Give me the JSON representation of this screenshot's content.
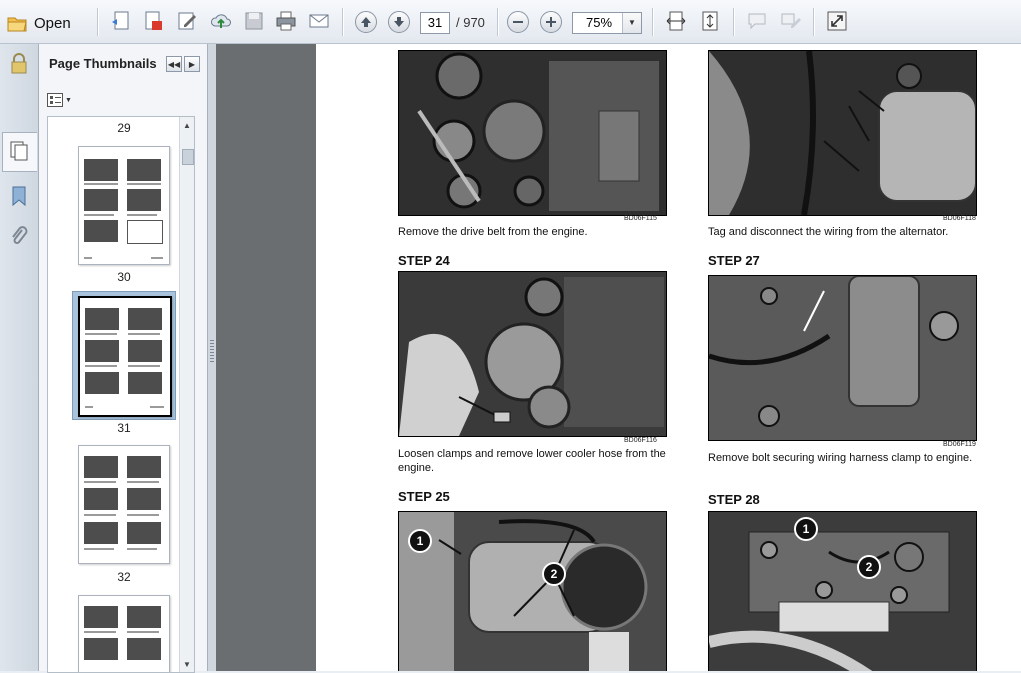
{
  "toolbar": {
    "open_label": "Open",
    "current_page": "31",
    "total_pages": "/ 970",
    "zoom": "75%",
    "icons": [
      "open-folder-icon",
      "create-pdf-icon",
      "edit-icon",
      "sign-icon",
      "upload-icon",
      "save-icon",
      "print-icon",
      "email-icon",
      "page-up-icon",
      "page-down-icon",
      "zoom-out-icon",
      "zoom-in-icon",
      "fit-width-icon",
      "fit-page-icon",
      "comment-icon",
      "highlight-icon",
      "full-screen-icon"
    ]
  },
  "sidebar": {
    "title": "Page Thumbnails",
    "rail_icons": [
      "lock-icon",
      "pages-icon",
      "bookmark-icon",
      "attachment-icon"
    ],
    "thumbnails": [
      {
        "number": "29"
      },
      {
        "number": "30"
      },
      {
        "number": "31",
        "selected": true
      },
      {
        "number": "32"
      }
    ]
  },
  "document": {
    "left_column": {
      "photo1_code": "BD06F115",
      "caption1": "Remove the drive belt from the engine.",
      "step24": "STEP 24",
      "photo2_code": "BD06F116",
      "caption2": "Loosen clamps and remove lower cooler hose from the engine.",
      "step25": "STEP 25",
      "callout_1": "1",
      "callout_2": "2"
    },
    "right_column": {
      "photo1_code": "BD06F118",
      "caption1": "Tag and disconnect the wiring from the alternator.",
      "step27": "STEP 27",
      "photo2_code": "BD06F119",
      "caption2": "Remove bolt securing wiring harness clamp to engine.",
      "step28": "STEP 28",
      "callout_1": "1",
      "callout_2": "2"
    }
  }
}
